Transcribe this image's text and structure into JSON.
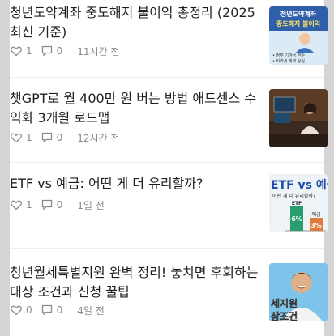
{
  "posts": [
    {
      "title": "청년도약계좌 중도해지 불이익 총정리 (2025 최신 기준)",
      "likes": "1",
      "comments": "0",
      "time": "11시간 전",
      "thumb": {
        "line1": "청년도약계좌",
        "line2": "중도해지 불이익",
        "bullet1": "• 정부 기여금 환수",
        "bullet2": "• 비과세 혜택 상실"
      }
    },
    {
      "title": "챗GPT로 월 400만 원 버는 방법 애드센스 수익화 3개월 로드맵",
      "likes": "1",
      "comments": "0",
      "time": "12시간 전"
    },
    {
      "title": "ETF vs 예금: 어떤 게 더 유리할까?",
      "likes": "1",
      "comments": "0",
      "time": "1일 전",
      "thumb": {
        "heading": "ETF vs 예금",
        "sub": "어떤 게 더 유리할까?",
        "bar1_label": "ETF",
        "bar1_value": "6%",
        "bar2_label": "예금",
        "bar2_value": "3%"
      }
    },
    {
      "title": "청년월세특별지원 완벽 정리! 놓치면 후회하는 대상 조건과 신청 꿀팁",
      "likes": "0",
      "comments": "0",
      "time": "4일 전",
      "thumb": {
        "line1": "세지원",
        "line2": "상조건"
      }
    }
  ]
}
